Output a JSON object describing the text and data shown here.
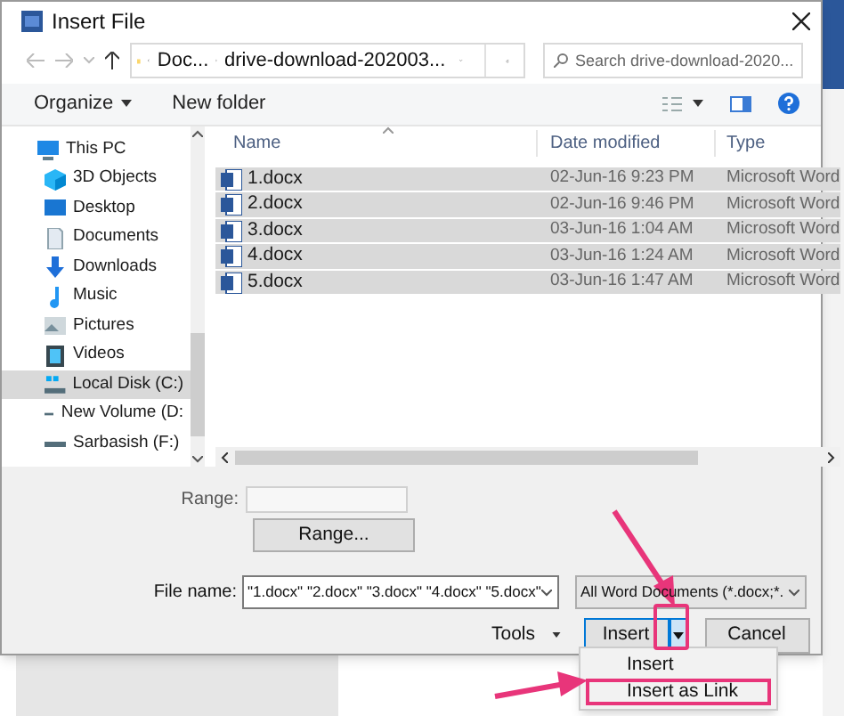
{
  "window": {
    "title": "Insert File"
  },
  "address": {
    "segments": [
      "Doc...",
      "drive-download-202003..."
    ]
  },
  "search": {
    "placeholder": "Search drive-download-2020..."
  },
  "toolbar": {
    "organize": "Organize",
    "new_folder": "New folder"
  },
  "nav_items": [
    {
      "label": "This PC",
      "kind": "pc",
      "selected": false,
      "children": [
        {
          "label": "3D Objects",
          "kind": "cube",
          "selected": false
        },
        {
          "label": "Desktop",
          "kind": "desktop",
          "selected": false
        },
        {
          "label": "Documents",
          "kind": "document",
          "selected": false
        },
        {
          "label": "Downloads",
          "kind": "download",
          "selected": false
        },
        {
          "label": "Music",
          "kind": "music",
          "selected": false
        },
        {
          "label": "Pictures",
          "kind": "pictures",
          "selected": false
        },
        {
          "label": "Videos",
          "kind": "videos",
          "selected": false
        },
        {
          "label": "Local Disk (C:)",
          "kind": "disk",
          "selected": true
        },
        {
          "label": "New Volume (D:",
          "kind": "drive",
          "selected": false
        },
        {
          "label": "Sarbasish (F:)",
          "kind": "drive",
          "selected": false
        }
      ]
    }
  ],
  "columns": [
    "Name",
    "Date modified",
    "Type"
  ],
  "files": [
    {
      "name": "1.docx",
      "date": "02-Jun-16 9:23 PM",
      "type": "Microsoft Word",
      "selected": true
    },
    {
      "name": "2.docx",
      "date": "02-Jun-16 9:46 PM",
      "type": "Microsoft Word",
      "selected": true
    },
    {
      "name": "3.docx",
      "date": "03-Jun-16 1:04 AM",
      "type": "Microsoft Word",
      "selected": true
    },
    {
      "name": "4.docx",
      "date": "03-Jun-16 1:24 AM",
      "type": "Microsoft Word",
      "selected": true
    },
    {
      "name": "5.docx",
      "date": "03-Jun-16 1:47 AM",
      "type": "Microsoft Word",
      "selected": true
    }
  ],
  "range": {
    "label": "Range:",
    "button": "Range..."
  },
  "file_name": {
    "label": "File name:",
    "value": "\"1.docx\" \"2.docx\" \"3.docx\" \"4.docx\" \"5.docx\""
  },
  "filter": {
    "value": "All Word Documents (*.docx;*."
  },
  "buttons": {
    "tools": "Tools",
    "insert": "Insert",
    "cancel": "Cancel"
  },
  "menu": [
    {
      "label": "Insert",
      "annotated": false
    },
    {
      "label": "Insert as Link",
      "annotated": true
    }
  ]
}
